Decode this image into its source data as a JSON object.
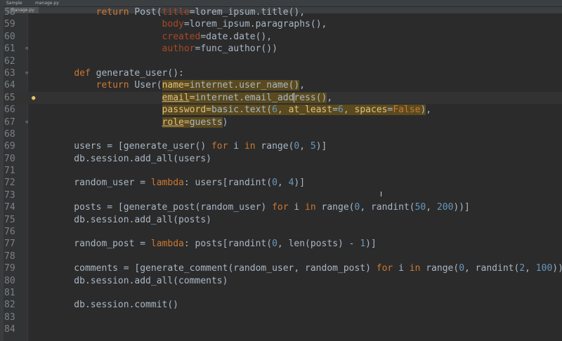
{
  "breadcrumbs": {
    "project": "Sample",
    "file": "manage.py"
  },
  "tab": {
    "label": "manage.py"
  },
  "editor": {
    "caret_line": 65,
    "lines": [
      {
        "n": "58",
        "text": "        return Post(title=lorem_ipsum.title(),"
      },
      {
        "n": "59",
        "text": "                    body=lorem_ipsum.paragraphs(),"
      },
      {
        "n": "60",
        "text": "                    created=date.date(),"
      },
      {
        "n": "61",
        "text": "                    author=func_author())"
      },
      {
        "n": "62",
        "text": ""
      },
      {
        "n": "63",
        "text": "    def generate_user():"
      },
      {
        "n": "64",
        "text": "        return User(name=internet.user_name(),"
      },
      {
        "n": "65",
        "text": "                    email=internet.email_address(),"
      },
      {
        "n": "66",
        "text": "                    password=basic.text(6, at_least=6, spaces=False),"
      },
      {
        "n": "67",
        "text": "                    role=guests)"
      },
      {
        "n": "68",
        "text": ""
      },
      {
        "n": "69",
        "text": "    users = [generate_user() for i in range(0, 5)]"
      },
      {
        "n": "70",
        "text": "    db.session.add_all(users)"
      },
      {
        "n": "71",
        "text": ""
      },
      {
        "n": "72",
        "text": "    random_user = lambda: users[randint(0, 4)]"
      },
      {
        "n": "73",
        "text": ""
      },
      {
        "n": "74",
        "text": "    posts = [generate_post(random_user) for i in range(0, randint(50, 200))]"
      },
      {
        "n": "75",
        "text": "    db.session.add_all(posts)"
      },
      {
        "n": "76",
        "text": ""
      },
      {
        "n": "77",
        "text": "    random_post = lambda: posts[randint(0, len(posts) - 1)]"
      },
      {
        "n": "78",
        "text": ""
      },
      {
        "n": "79",
        "text": "    comments = [generate_comment(random_user, random_post) for i in range(0, randint(2, 100))"
      },
      {
        "n": "80",
        "text": "    db.session.add_all(comments)"
      },
      {
        "n": "81",
        "text": ""
      },
      {
        "n": "82",
        "text": "    db.session.commit()"
      },
      {
        "n": "83",
        "text": ""
      },
      {
        "n": "84",
        "text": ""
      }
    ]
  },
  "colors": {
    "background": "#2b2b2b",
    "keyword": "#cc7832",
    "number": "#6897bb",
    "named_arg": "#aa4926",
    "highlight": "#5a4a1e",
    "default_text": "#a9b7c6"
  },
  "icons": [
    "fold-marker-icon",
    "intention-bulb-icon",
    "text-cursor-icon"
  ]
}
